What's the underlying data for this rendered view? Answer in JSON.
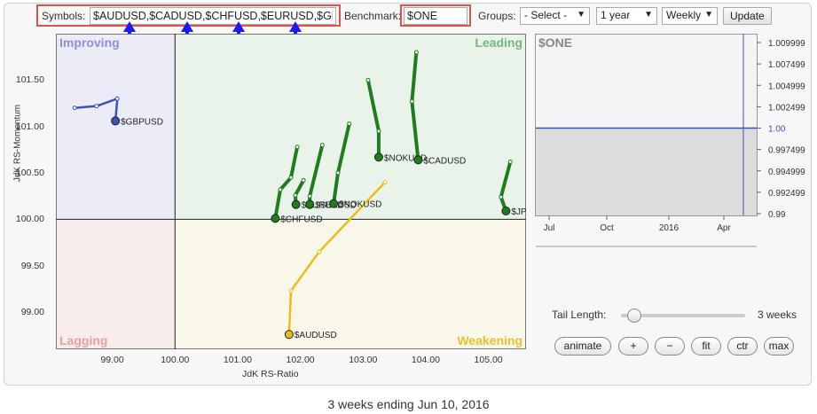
{
  "toolbar": {
    "symbols_label": "Symbols:",
    "symbols_value": "$AUDUSD,$CADUSD,$CHFUSD,$EURUSD,$GBF",
    "benchmark_label": "Benchmark:",
    "benchmark_value": "$ONE",
    "groups_label": "Groups:",
    "groups_selected": "- Select -",
    "period_selected": "1 year",
    "frequency_selected": "Weekly",
    "update_label": "Update"
  },
  "chart_data": {
    "type": "scatter",
    "xlabel": "JdK RS-Ratio",
    "ylabel": "JdK RS-Momentum",
    "xlim": [
      98.1,
      105.6
    ],
    "ylim": [
      98.6,
      102.0
    ],
    "x_ticks": [
      "99.00",
      "100.00",
      "101.00",
      "102.00",
      "103.00",
      "104.00",
      "105.00"
    ],
    "y_ticks": [
      "101.50",
      "101.00",
      "100.50",
      "100.00",
      "99.50",
      "99.00"
    ],
    "center": [
      100,
      100
    ],
    "quadrants": {
      "top_left": "Improving",
      "top_right": "Leading",
      "bottom_left": "Lagging",
      "bottom_right": "Weakening"
    },
    "series": [
      {
        "name": "$GBPUSD",
        "color": "#3f51b5",
        "x": [
          98.4,
          98.75,
          99.08,
          99.05
        ],
        "y": [
          101.2,
          101.22,
          101.3,
          101.06
        ]
      },
      {
        "name": "$AUDUSD",
        "color": "#e8c015",
        "x": [
          103.35,
          102.3,
          101.85,
          101.82
        ],
        "y": [
          100.4,
          99.65,
          99.23,
          98.76
        ]
      },
      {
        "name": "$CHFUSD",
        "color": "#1e7e1e",
        "x": [
          101.95,
          101.85,
          101.68,
          101.6
        ],
        "y": [
          100.78,
          100.45,
          100.32,
          100.01
        ]
      },
      {
        "name": "$EURUSD",
        "color": "#1e7e1e",
        "x": [
          102.05,
          101.92,
          101.93
        ],
        "y": [
          100.42,
          100.26,
          100.16
        ]
      },
      {
        "name": "$SEKUSD",
        "color": "#1e7e1e",
        "x": [
          102.35,
          102.15,
          102.15
        ],
        "y": [
          100.8,
          100.25,
          100.16
        ]
      },
      {
        "name": "$NOKUSD",
        "color": "#1e7e1e",
        "x": [
          102.78,
          102.6,
          102.53
        ],
        "y": [
          101.03,
          100.5,
          100.17
        ]
      },
      {
        "name": "$NOKUSD",
        "color": "#1e7e1e",
        "x": [
          103.08,
          103.25,
          103.25
        ],
        "y": [
          101.5,
          100.95,
          100.67
        ]
      },
      {
        "name": "$CADUSD",
        "color": "#1e7e1e",
        "x": [
          103.85,
          103.78,
          103.88
        ],
        "y": [
          101.8,
          101.27,
          100.64
        ]
      },
      {
        "name": "$JPYUSD",
        "color": "#1e7e1e",
        "x": [
          105.35,
          105.2,
          105.28
        ],
        "y": [
          100.62,
          100.24,
          100.09
        ]
      }
    ]
  },
  "benchmark_chart": {
    "title": "$ONE",
    "y_ticks": [
      "1.009999",
      "1.007499",
      "1.004999",
      "1.002499",
      "1.00",
      "0.997499",
      "0.994999",
      "0.992499",
      "0.99"
    ],
    "x_ticks": [
      "Jul",
      "Oct",
      "2016",
      "Apr"
    ],
    "value_line_color": "#3f51b5"
  },
  "controls": {
    "tail_label": "Tail Length:",
    "tail_value": "3 weeks",
    "tail_fraction": 0.1,
    "buttons": [
      "animate",
      "+",
      "−",
      "fit",
      "ctr",
      "max"
    ]
  },
  "footer": "3 weeks ending Jun 10, 2016",
  "colors": {
    "highlight": "#d9534f",
    "arrow": "#1a1aff"
  }
}
